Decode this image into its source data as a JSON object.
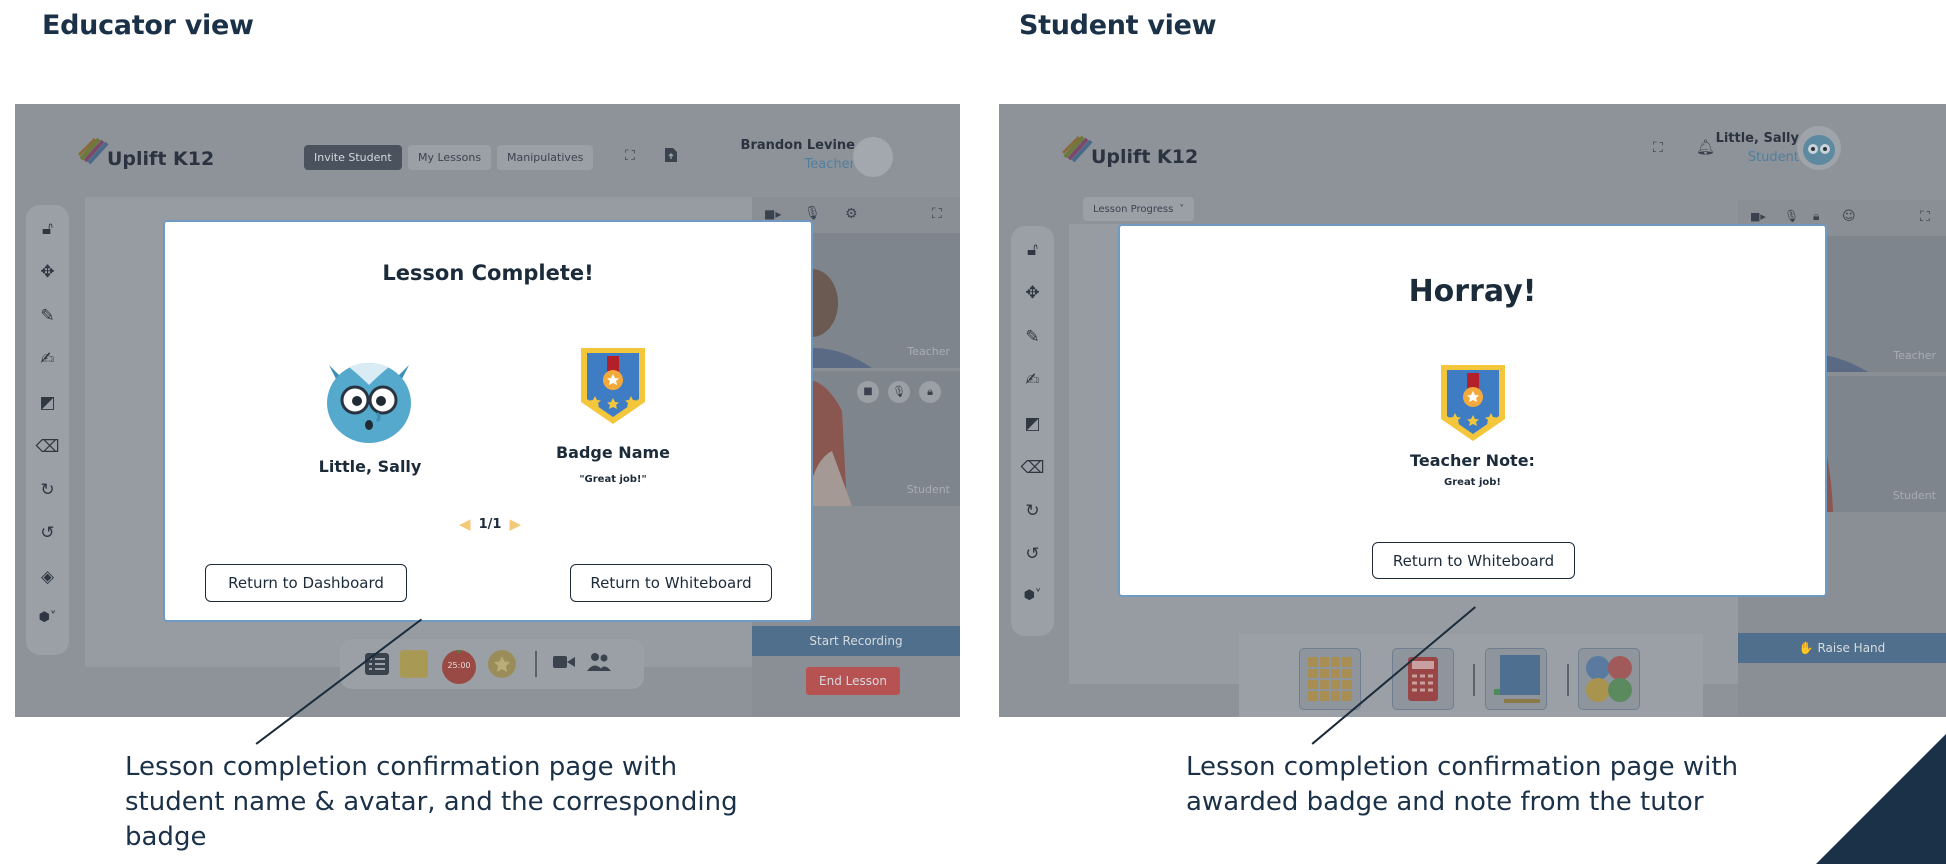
{
  "educator": {
    "section_title": "Educator view",
    "logo": "Uplift K12",
    "nav": [
      "Invite Student",
      "My Lessons",
      "Manipulatives"
    ],
    "user_name": "Brandon Levine",
    "user_role": "Teacher",
    "video_labels": [
      "Teacher",
      "Student"
    ],
    "start_recording": "Start Recording",
    "end_lesson": "End Lesson",
    "timer": "25:00",
    "modal": {
      "title": "Lesson Complete!",
      "student_name": "Little, Sally",
      "badge_name": "Badge Name",
      "badge_note": "\"Great job!\"",
      "pager": "1/1",
      "return_dashboard": "Return to Dashboard",
      "return_whiteboard": "Return to Whiteboard"
    },
    "caption": "Lesson completion confirmation page with student name & avatar, and the corresponding badge"
  },
  "student": {
    "section_title": "Student view",
    "logo": "Uplift K12",
    "user_name": "Little, Sally",
    "user_role": "Student",
    "lesson_progress": "Lesson Progress",
    "video_labels": [
      "Teacher",
      "Student"
    ],
    "raise_hand": "✋ Raise Hand",
    "modal": {
      "title": "Horray!",
      "note_label": "Teacher Note:",
      "note_text": "Great job!",
      "return_whiteboard": "Return to Whiteboard"
    },
    "caption": "Lesson completion confirmation page with awarded badge and note from the tutor"
  },
  "colors": {
    "overlay": "#8e939a",
    "accent_blue": "#4f7fa0",
    "modal_border": "#6f9ac2",
    "recording_bar": "#4f7fa0",
    "end_lesson": "#c95a5a",
    "navy": "#1b3148"
  },
  "icons": {
    "toolbar": [
      "lock-icon",
      "move-icon",
      "pen-icon",
      "signature-icon",
      "sticky-note-icon",
      "eraser-icon",
      "redo-icon",
      "undo-icon",
      "fill-icon",
      "shapes-icon"
    ],
    "dock_educator": [
      "checklist-icon",
      "sticky-note-icon",
      "timer-icon",
      "badge-icon",
      "video-icon",
      "people-icon"
    ],
    "dock_student": [
      "grid-manipulative-icon",
      "calculator-icon",
      "hundred-grid-icon",
      "counters-icon"
    ]
  }
}
